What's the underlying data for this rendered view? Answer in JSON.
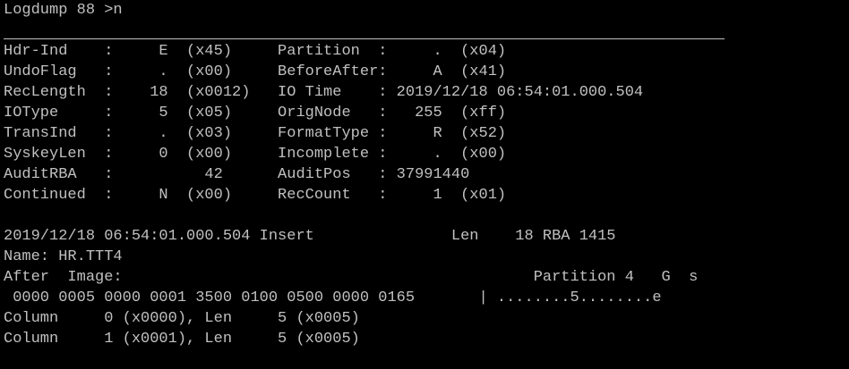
{
  "terminal": {
    "prompt_line": "Logdump 88 >n",
    "rows": [
      "Hdr-Ind    :     E  (x45)     Partition  :     .  (x04)",
      "UndoFlag   :     .  (x00)     BeforeAfter:     A  (x41)",
      "RecLength  :    18  (x0012)   IO Time    : 2019/12/18 06:54:01.000.504",
      "IOType     :     5  (x05)     OrigNode   :   255  (xff)",
      "TransInd   :     .  (x03)     FormatType :     R  (x52)",
      "SyskeyLen  :     0  (x00)     Incomplete :     .  (x00)",
      "AuditRBA   :          42      AuditPos   : 37991440",
      "Continued  :     N  (x00)     RecCount   :     1  (x01)"
    ],
    "record_lines": [
      "2019/12/18 06:54:01.000.504 Insert               Len    18 RBA 1415",
      "Name: HR.TTT4",
      "After  Image:                                             Partition 4   G  s",
      " 0000 0005 0000 0001 3500 0100 0500 0000 0165       | ........5........e",
      "Column     0 (x0000), Len     5 (x0005)",
      "Column     1 (x0001), Len     5 (x0005)"
    ]
  },
  "colors": {
    "background": "#000000",
    "foreground": "#c0c0c0"
  }
}
